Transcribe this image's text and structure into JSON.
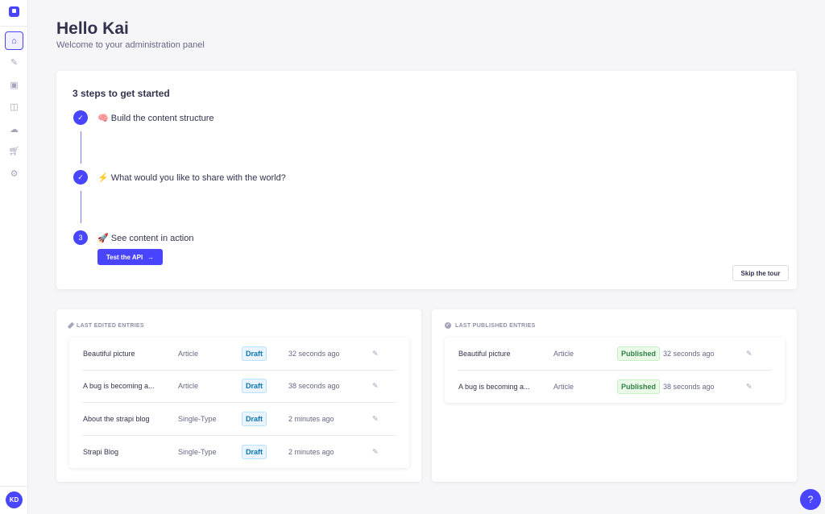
{
  "sidebar": {
    "items": [
      {
        "icon": "home-icon",
        "active": true
      },
      {
        "icon": "feather-icon"
      },
      {
        "icon": "media-icon"
      },
      {
        "icon": "layout-icon"
      },
      {
        "icon": "cloud-icon"
      },
      {
        "icon": "cart-icon"
      },
      {
        "icon": "gear-icon"
      }
    ],
    "avatar": "KD"
  },
  "header": {
    "title": "Hello Kai",
    "subtitle": "Welcome to your administration panel"
  },
  "steps": {
    "title": "3 steps to get started",
    "items": [
      {
        "marker": "✓",
        "label": "🧠 Build the content structure",
        "done": true
      },
      {
        "marker": "✓",
        "label": "⚡ What would you like to share with the world?",
        "done": true
      },
      {
        "marker": "3",
        "label": "🚀 See content in action",
        "done": false
      }
    ],
    "cta": "Test the API",
    "skip": "Skip the tour"
  },
  "last_edited": {
    "title": "LAST EDITED ENTRIES",
    "rows": [
      {
        "name": "Beautiful picture",
        "type": "Article",
        "status": "Draft",
        "time": "32 seconds ago"
      },
      {
        "name": "A bug is becoming a...",
        "type": "Article",
        "status": "Draft",
        "time": "38 seconds ago"
      },
      {
        "name": "About the strapi blog",
        "type": "Single-Type",
        "status": "Draft",
        "time": "2 minutes ago"
      },
      {
        "name": "Strapi Blog",
        "type": "Single-Type",
        "status": "Draft",
        "time": "2 minutes ago"
      }
    ]
  },
  "last_published": {
    "title": "LAST PUBLISHED ENTRIES",
    "rows": [
      {
        "name": "Beautiful picture",
        "type": "Article",
        "status": "Published",
        "time": "32 seconds ago"
      },
      {
        "name": "A bug is becoming a...",
        "type": "Article",
        "status": "Published",
        "time": "38 seconds ago"
      }
    ]
  },
  "colors": {
    "primary": "#4945ff",
    "draft": "#0c75af",
    "published": "#328048"
  }
}
